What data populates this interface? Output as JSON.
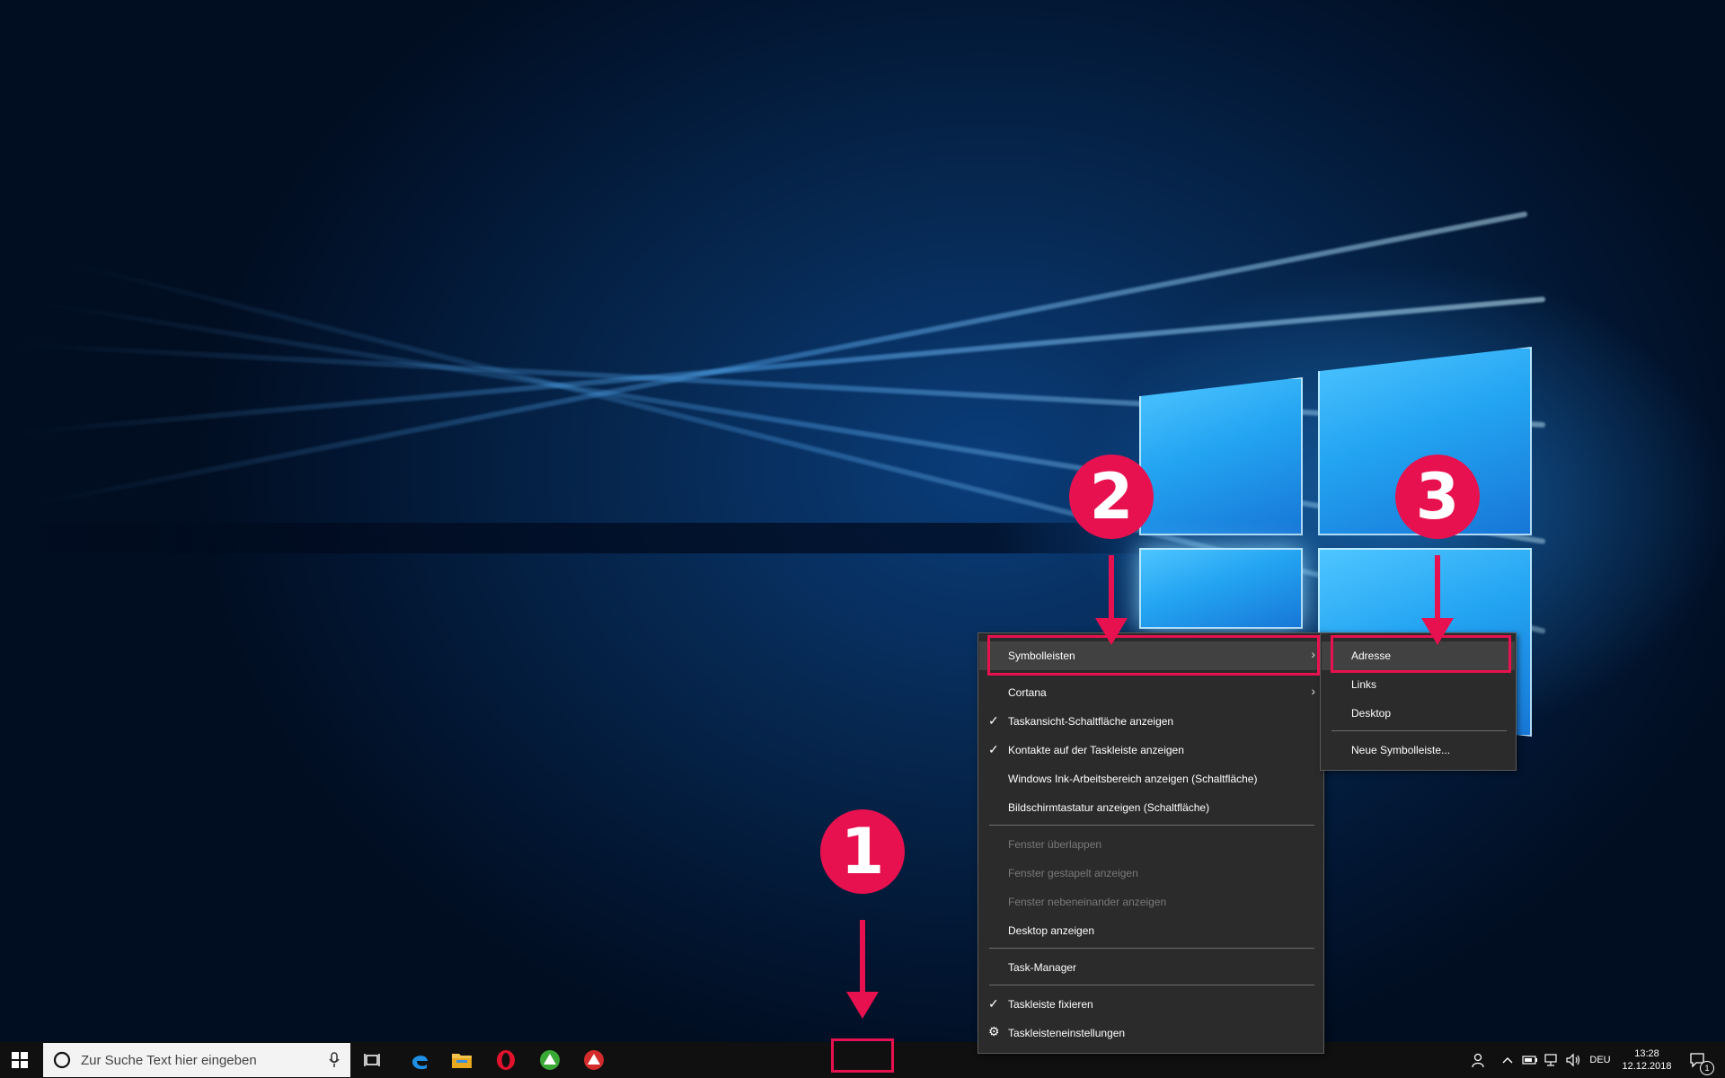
{
  "taskbar": {
    "search_placeholder": "Zur Suche Text hier eingeben",
    "language": "DEU",
    "time": "13:28",
    "date": "12.12.2018",
    "notification_count": "1"
  },
  "context_menu": {
    "items": [
      {
        "label": "Symbolleisten",
        "submenu": true,
        "highlighted": true
      },
      {
        "label": "Cortana",
        "submenu": true
      },
      {
        "label": "Taskansicht-Schaltfläche anzeigen",
        "checked": true
      },
      {
        "label": "Kontakte auf der Taskleiste anzeigen",
        "checked": true
      },
      {
        "label": "Windows Ink-Arbeitsbereich anzeigen (Schaltfläche)"
      },
      {
        "label": "Bildschirmtastatur anzeigen (Schaltfläche)"
      },
      {
        "label": "Fenster überlappen",
        "disabled": true
      },
      {
        "label": "Fenster gestapelt anzeigen",
        "disabled": true
      },
      {
        "label": "Fenster nebeneinander anzeigen",
        "disabled": true
      },
      {
        "label": "Desktop anzeigen"
      },
      {
        "label": "Task-Manager"
      },
      {
        "label": "Taskleiste fixieren",
        "checked": true
      },
      {
        "label": "Taskleisteneinstellungen",
        "icon": "gear-icon"
      }
    ]
  },
  "submenu": {
    "items": [
      {
        "label": "Adresse",
        "highlighted": true
      },
      {
        "label": "Links"
      },
      {
        "label": "Desktop"
      },
      {
        "label": "Neue Symbolleiste..."
      }
    ]
  },
  "annotations": {
    "step1": "1",
    "step2": "2",
    "step3": "3",
    "color": "#e8114f"
  }
}
